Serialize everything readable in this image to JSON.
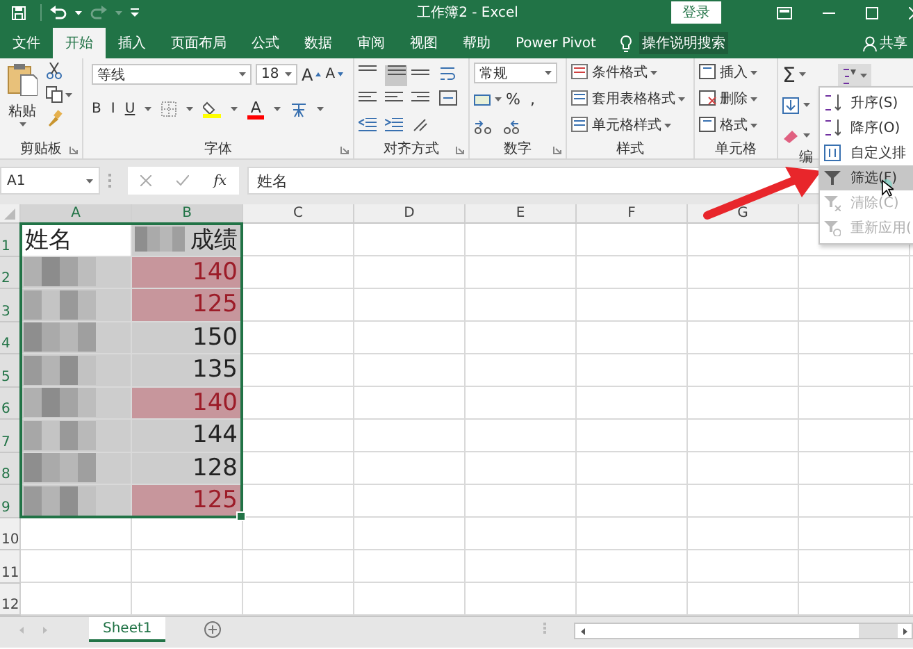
{
  "window": {
    "title": "工作簿2 - Excel",
    "sign_in": "登录"
  },
  "tabs": [
    {
      "label": "文件",
      "selected": false
    },
    {
      "label": "开始",
      "selected": true
    },
    {
      "label": "插入",
      "selected": false
    },
    {
      "label": "页面布局",
      "selected": false
    },
    {
      "label": "公式",
      "selected": false
    },
    {
      "label": "数据",
      "selected": false
    },
    {
      "label": "审阅",
      "selected": false
    },
    {
      "label": "视图",
      "selected": false
    },
    {
      "label": "帮助",
      "selected": false
    },
    {
      "label": "Power Pivot",
      "selected": false
    }
  ],
  "tell_me": "操作说明搜索",
  "share": "共享",
  "ribbon": {
    "clipboard": {
      "paste": "粘贴",
      "label": "剪贴板"
    },
    "font": {
      "name": "等线",
      "size": "18",
      "grow": "A",
      "shrink": "A",
      "bold": "B",
      "italic": "I",
      "underline": "U",
      "font_color_letter": "A",
      "label": "字体"
    },
    "alignment": {
      "label": "对齐方式"
    },
    "number": {
      "format": "常规",
      "percent": "%",
      "comma": ",",
      "label": "数字"
    },
    "styles": {
      "items": [
        "条件格式",
        "套用表格格式",
        "单元格样式"
      ],
      "label": "样式"
    },
    "cells": {
      "items": [
        "插入",
        "删除",
        "格式"
      ],
      "label": "单元格"
    },
    "editing": {
      "sum": "Σ",
      "label": "编"
    }
  },
  "sort_menu": [
    {
      "label": "升序(S)",
      "selected": false,
      "disabled": false
    },
    {
      "label": "降序(O)",
      "selected": false,
      "disabled": false
    },
    {
      "label": "自定义排",
      "selected": false,
      "disabled": false
    },
    {
      "label": "筛选(F)",
      "selected": true,
      "disabled": false
    },
    {
      "label": "清除(C)",
      "selected": false,
      "disabled": true
    },
    {
      "label": "重新应用(",
      "selected": false,
      "disabled": true
    }
  ],
  "formula_bar": {
    "name_box": "A1",
    "fx": "fx",
    "formula": "姓名"
  },
  "columns": [
    {
      "label": "A",
      "selected": true
    },
    {
      "label": "B",
      "selected": true
    },
    {
      "label": "C",
      "selected": false
    },
    {
      "label": "D",
      "selected": false
    },
    {
      "label": "E",
      "selected": false
    },
    {
      "label": "F",
      "selected": false
    },
    {
      "label": "G",
      "selected": false
    }
  ],
  "rows": [
    {
      "number": "1",
      "cells": [
        {
          "kind": "text",
          "text": "姓名",
          "selected": true,
          "active": true,
          "highlight": false
        },
        {
          "kind": "blurred_text",
          "text": "成绩",
          "selected": true,
          "active": false,
          "highlight": false
        }
      ]
    },
    {
      "number": "2",
      "cells": [
        {
          "kind": "blurred",
          "selected": true,
          "active": false,
          "highlight": false
        },
        {
          "kind": "text",
          "text": "140",
          "selected": true,
          "active": false,
          "highlight": true
        }
      ]
    },
    {
      "number": "3",
      "cells": [
        {
          "kind": "blurred",
          "selected": true,
          "active": false,
          "highlight": false
        },
        {
          "kind": "text",
          "text": "125",
          "selected": true,
          "active": false,
          "highlight": true
        }
      ]
    },
    {
      "number": "4",
      "cells": [
        {
          "kind": "blurred",
          "selected": true,
          "active": false,
          "highlight": false
        },
        {
          "kind": "text",
          "text": "150",
          "selected": true,
          "active": false,
          "highlight": false
        }
      ]
    },
    {
      "number": "5",
      "cells": [
        {
          "kind": "blurred",
          "selected": true,
          "active": false,
          "highlight": false
        },
        {
          "kind": "text",
          "text": "135",
          "selected": true,
          "active": false,
          "highlight": false
        }
      ]
    },
    {
      "number": "6",
      "cells": [
        {
          "kind": "blurred",
          "selected": true,
          "active": false,
          "highlight": false
        },
        {
          "kind": "text",
          "text": "140",
          "selected": true,
          "active": false,
          "highlight": true
        }
      ]
    },
    {
      "number": "7",
      "cells": [
        {
          "kind": "blurred",
          "selected": true,
          "active": false,
          "highlight": false
        },
        {
          "kind": "text",
          "text": "144",
          "selected": true,
          "active": false,
          "highlight": false
        }
      ]
    },
    {
      "number": "8",
      "cells": [
        {
          "kind": "blurred",
          "selected": true,
          "active": false,
          "highlight": false
        },
        {
          "kind": "text",
          "text": "128",
          "selected": true,
          "active": false,
          "highlight": false
        }
      ]
    },
    {
      "number": "9",
      "cells": [
        {
          "kind": "blurred",
          "selected": true,
          "active": false,
          "highlight": false
        },
        {
          "kind": "text",
          "text": "125",
          "selected": true,
          "active": false,
          "highlight": true
        }
      ]
    },
    {
      "number": "10"
    },
    {
      "number": "11"
    },
    {
      "number": "12"
    }
  ],
  "sheets": [
    {
      "label": "Sheet1",
      "selected": true
    }
  ]
}
